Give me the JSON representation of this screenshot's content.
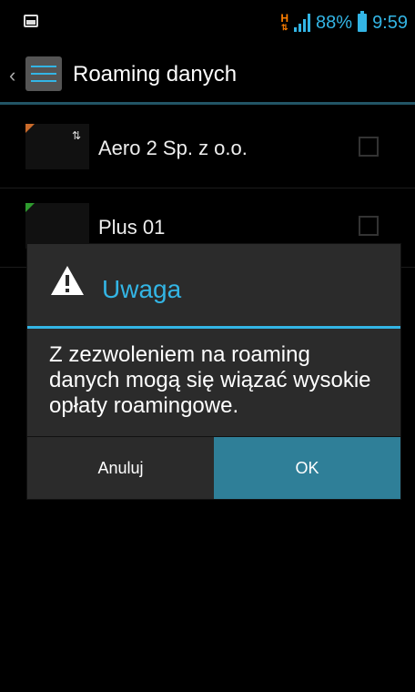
{
  "status_bar": {
    "network_type": "H",
    "battery_percent": "88%",
    "time": "9:59"
  },
  "action_bar": {
    "title": "Roaming danych",
    "back_icon": "chevron-left-icon",
    "app_icon": "settings-icon"
  },
  "list": {
    "items": [
      {
        "label": "Aero 2 Sp. z o.o.",
        "indicator_color": "#c96a2a",
        "data_arrows": "⇅",
        "checked": false
      },
      {
        "label": "Plus 01",
        "indicator_color": "#2e9b2e",
        "data_arrows": "",
        "checked": false
      }
    ]
  },
  "dialog": {
    "title": "Uwaga",
    "message": "Z zezwoleniem na roaming danych mogą się wiązać wysokie opłaty roamingowe.",
    "cancel_label": "Anuluj",
    "ok_label": "OK"
  },
  "colors": {
    "accent": "#33b5e5",
    "ok_button": "#2f7f98",
    "dialog_bg": "#2b2b2b"
  }
}
